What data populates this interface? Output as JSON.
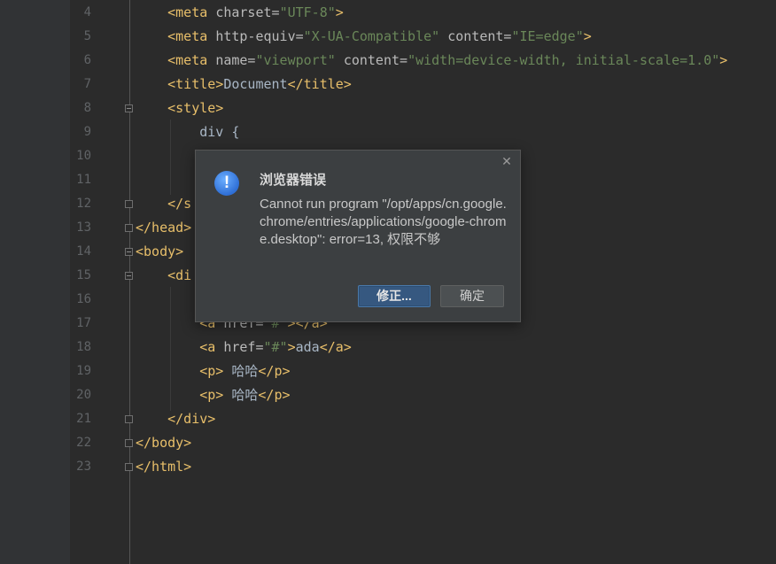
{
  "editor": {
    "lines": [
      {
        "num": "4",
        "fold": null,
        "html": "    <span class=\"tag\">&lt;meta</span> <span class=\"attr\">charset=</span><span class=\"str\">\"UTF-8\"</span><span class=\"tag\">&gt;</span>"
      },
      {
        "num": "5",
        "fold": null,
        "html": "    <span class=\"tag\">&lt;meta</span> <span class=\"attr\">http-equiv=</span><span class=\"str\">\"X-UA-Compatible\"</span> <span class=\"attr\">content=</span><span class=\"str\">\"IE=edge\"</span><span class=\"tag\">&gt;</span>"
      },
      {
        "num": "6",
        "fold": null,
        "html": "    <span class=\"tag\">&lt;meta</span> <span class=\"attr\">name=</span><span class=\"str\">\"viewport\"</span> <span class=\"attr\">content=</span><span class=\"str\">\"width=device-width, initial-scale=1.0\"</span><span class=\"tag\">&gt;</span>"
      },
      {
        "num": "7",
        "fold": null,
        "html": "    <span class=\"tag\">&lt;title&gt;</span><span class=\"txt\">Document</span><span class=\"tag\">&lt;/title&gt;</span>"
      },
      {
        "num": "8",
        "fold": "open",
        "html": "    <span class=\"tag\">&lt;style&gt;</span>"
      },
      {
        "num": "9",
        "fold": null,
        "html": "        <span class=\"txt\">div {</span>"
      },
      {
        "num": "10",
        "fold": null,
        "html": ""
      },
      {
        "num": "11",
        "fold": null,
        "html": ""
      },
      {
        "num": "12",
        "fold": "close",
        "html": "    <span class=\"tag\">&lt;/s</span>"
      },
      {
        "num": "13",
        "fold": "close",
        "html": "<span class=\"tag\">&lt;/head&gt;</span>"
      },
      {
        "num": "14",
        "fold": "open",
        "html": "<span class=\"tag\">&lt;body&gt;</span>"
      },
      {
        "num": "15",
        "fold": "open",
        "html": "    <span class=\"tag\">&lt;di</span>"
      },
      {
        "num": "16",
        "fold": null,
        "html": ""
      },
      {
        "num": "17",
        "fold": null,
        "html": "        <span class=\"tag\">&lt;a</span> <span class=\"attr\">href=</span><span class=\"str\">\"#\"</span><span class=\"tag\">&gt;&lt;/a&gt;</span>"
      },
      {
        "num": "18",
        "fold": null,
        "html": "        <span class=\"tag\">&lt;a</span> <span class=\"attr\">href=</span><span class=\"str\">\"#\"</span><span class=\"tag\">&gt;</span><span class=\"txt\">ada</span><span class=\"tag\">&lt;/a&gt;</span>"
      },
      {
        "num": "19",
        "fold": null,
        "html": "        <span class=\"tag\">&lt;p&gt;</span> <span class=\"txt\">哈哈</span><span class=\"tag\">&lt;/p&gt;</span>"
      },
      {
        "num": "20",
        "fold": null,
        "html": "        <span class=\"tag\">&lt;p&gt;</span> <span class=\"txt\">哈哈</span><span class=\"tag\">&lt;/p&gt;</span>"
      },
      {
        "num": "21",
        "fold": "close",
        "html": "    <span class=\"tag\">&lt;/div&gt;</span>"
      },
      {
        "num": "22",
        "fold": "close",
        "html": "<span class=\"tag\">&lt;/body&gt;</span>"
      },
      {
        "num": "23",
        "fold": "close",
        "html": "<span class=\"tag\">&lt;/html&gt;</span>"
      }
    ]
  },
  "dialog": {
    "title": "浏览器错误",
    "message": "Cannot run program \"/opt/apps/cn.google.chrome/entries/applications/google-chrome.desktop\": error=13, 权限不够",
    "primary_button": "修正...",
    "secondary_button": "确定",
    "close_glyph": "✕",
    "icon_glyph": "!"
  }
}
